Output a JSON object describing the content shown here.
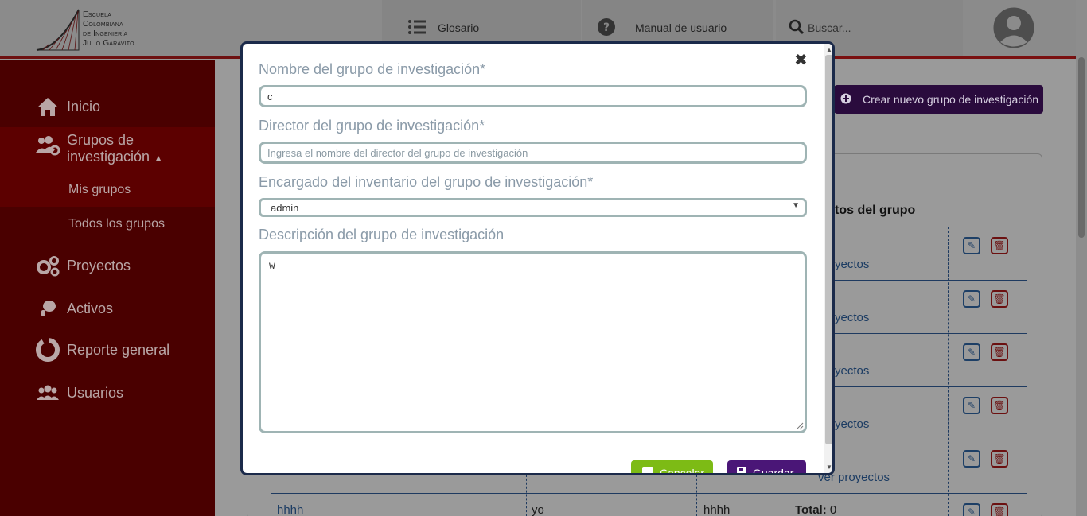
{
  "header": {
    "logo_lines": [
      "Escuela",
      "Colombiana",
      "de Ingeniería",
      "Julio Garavito"
    ],
    "glosario": "Glosario",
    "manual": "Manual de usuario",
    "search_placeholder": "Buscar..."
  },
  "sidebar": {
    "items": [
      {
        "label": "Inicio",
        "icon": "home-icon"
      },
      {
        "label": "Grupos de investigación",
        "icon": "users-cog-icon",
        "expanded": true
      },
      {
        "label": "Mis grupos"
      },
      {
        "label": "Todos los grupos"
      },
      {
        "label": "Proyectos",
        "icon": "gears-icon"
      },
      {
        "label": "Activos",
        "icon": "asset-icon"
      },
      {
        "label": "Reporte general",
        "icon": "chart-icon"
      },
      {
        "label": "Usuarios",
        "icon": "users-icon"
      }
    ],
    "group_line1": "Grupos de",
    "group_line2": "investigación"
  },
  "main": {
    "create_button": "Crear nuevo grupo de investigación",
    "column_header": "tos del grupo",
    "row_link": "yectos",
    "row_link_full": "ver proyectos",
    "bottom_row": {
      "name": "hhhh",
      "director": "yo",
      "inventory": "hhhh",
      "total_label": "Total:",
      "total_value": "0"
    }
  },
  "modal": {
    "name_label": "Nombre del grupo de investigación*",
    "name_value": "c",
    "director_label": "Director del grupo de investigación*",
    "director_placeholder": "Ingresa el nombre del director del grupo de investigación",
    "inventory_label": "Encargado del inventario del grupo de investigación*",
    "inventory_selected": "admin",
    "description_label": "Descripción del grupo de investigación",
    "description_value": "w",
    "cancel_label": "Cancelar",
    "save_label": "Guardar"
  },
  "colors": {
    "sidebar_bg": "#4a0000",
    "cancel_green": "#7dbb15",
    "save_purple": "#4a1677",
    "input_border": "#9fb4b4",
    "label_gray": "#8a9aa8"
  }
}
